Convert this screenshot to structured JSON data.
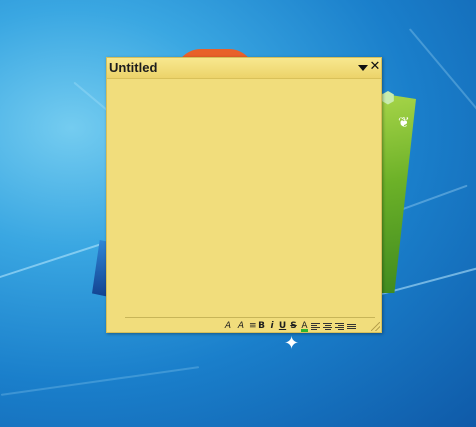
{
  "colors": {
    "note_background": "#f1dd7c",
    "note_titlebar": "#ecd36a",
    "desktop_blue": "#1a7fcb",
    "logo_orange": "#e8612a",
    "logo_green": "#6cb128",
    "logo_blue": "#12418f",
    "text_color_swatch": "#2fb52f"
  },
  "note": {
    "title": "Untitled",
    "body_text": "",
    "menu_icon": "triangle-down-icon",
    "close_icon": "close-icon",
    "close_glyph": "✕",
    "toolbar": [
      {
        "name": "decrease-font-size-button",
        "icon": "font-decrease-icon",
        "glyph": "A"
      },
      {
        "name": "increase-font-size-button",
        "icon": "font-increase-icon",
        "glyph": "A"
      },
      {
        "name": "bullet-button",
        "icon": "bullet-icon",
        "glyph": "≡"
      },
      {
        "name": "bold-button",
        "icon": "bold-icon",
        "glyph": "B"
      },
      {
        "name": "italic-button",
        "icon": "italic-icon",
        "glyph": "i"
      },
      {
        "name": "underline-button",
        "icon": "underline-icon",
        "glyph": "U"
      },
      {
        "name": "strikethrough-button",
        "icon": "strikethrough-icon",
        "glyph": "S"
      },
      {
        "name": "text-color-button",
        "icon": "text-color-icon",
        "glyph": "A"
      },
      {
        "name": "align-left-button",
        "icon": "align-left-icon"
      },
      {
        "name": "align-center-button",
        "icon": "align-center-icon"
      },
      {
        "name": "align-right-button",
        "icon": "align-right-icon"
      },
      {
        "name": "list-button",
        "icon": "list-icon"
      }
    ]
  }
}
